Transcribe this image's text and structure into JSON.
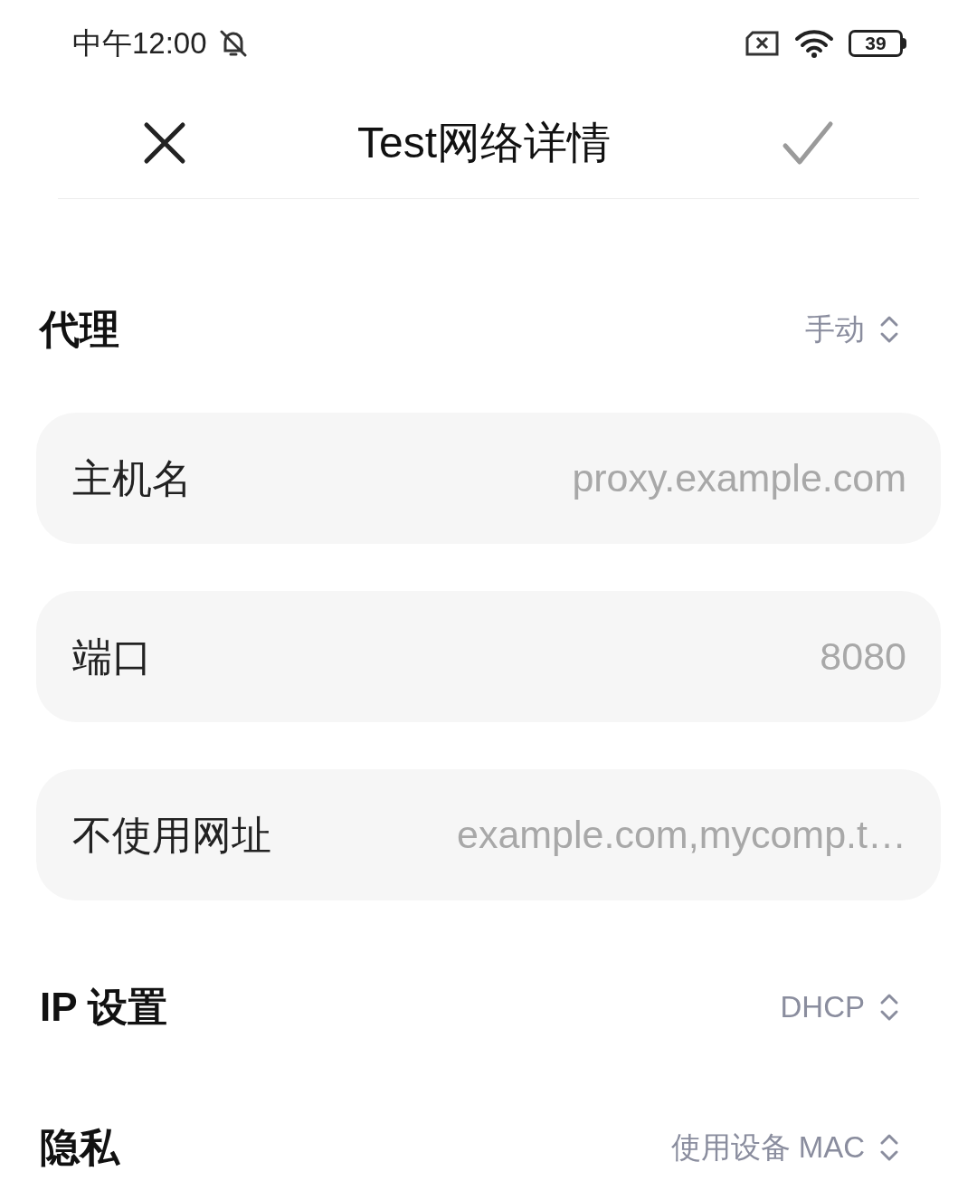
{
  "status_bar": {
    "time": "中午12:00",
    "battery": "39"
  },
  "header": {
    "title": "Test网络详情",
    "confirm": {
      "disabled": true
    }
  },
  "proxy": {
    "label": "代理",
    "value": "手动"
  },
  "fields": [
    {
      "label": "主机名",
      "placeholder": "proxy.example.com"
    },
    {
      "label": "端口",
      "placeholder": "8080"
    },
    {
      "label": "不使用网址",
      "placeholder": "example.com,mycomp.t…"
    }
  ],
  "settings": [
    {
      "label": "IP 设置",
      "value": "DHCP"
    },
    {
      "label": "隐私",
      "value": "使用设备 MAC"
    }
  ]
}
